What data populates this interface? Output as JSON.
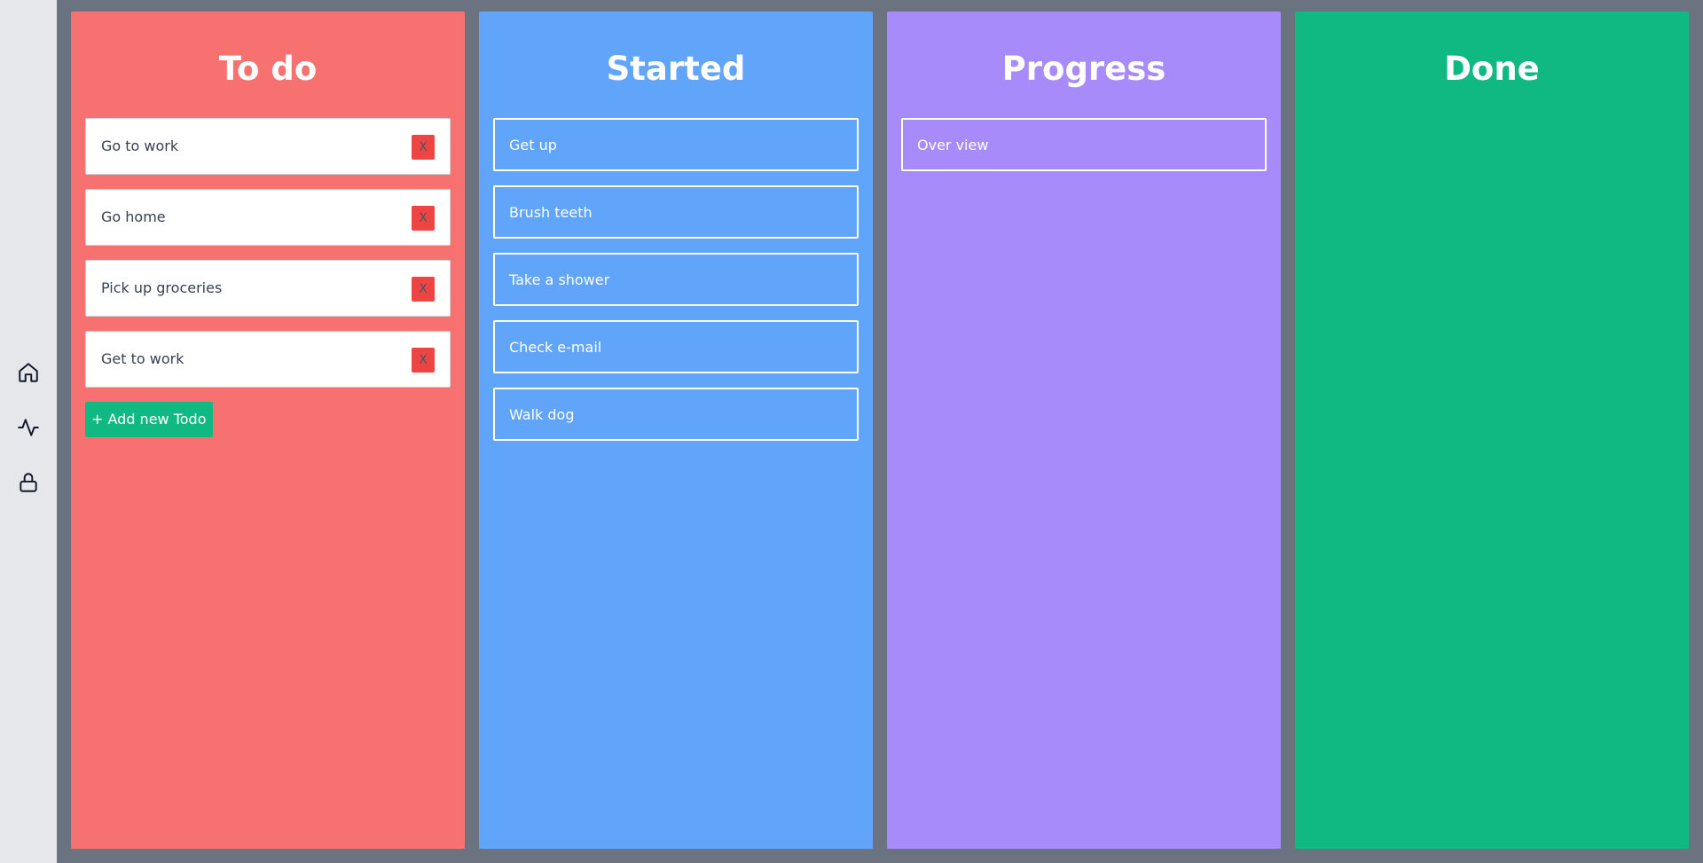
{
  "colors": {
    "sidebar_bg": "#e5e7eb",
    "board_bg": "#6b7280",
    "todo_col": "#f87171",
    "started_col": "#60a5fa",
    "progress_col": "#a78bfa",
    "done_col": "#10b981",
    "delete_btn": "#ef4444",
    "add_btn": "#10b981"
  },
  "sidebar": {
    "icons": [
      "home-icon",
      "activity-icon",
      "lock-icon"
    ]
  },
  "columns": {
    "todo": {
      "title": "To do",
      "cards": [
        {
          "text": "Go to work",
          "delete_label": "X"
        },
        {
          "text": "Go home",
          "delete_label": "X"
        },
        {
          "text": "Pick up groceries",
          "delete_label": "X"
        },
        {
          "text": "Get to work",
          "delete_label": "X"
        }
      ],
      "add_label": "+ Add new Todo"
    },
    "started": {
      "title": "Started",
      "cards": [
        {
          "text": "Get up"
        },
        {
          "text": "Brush teeth"
        },
        {
          "text": "Take a shower"
        },
        {
          "text": "Check e-mail"
        },
        {
          "text": "Walk dog"
        }
      ]
    },
    "progress": {
      "title": "Progress",
      "cards": [
        {
          "text": "Over view"
        }
      ]
    },
    "done": {
      "title": "Done",
      "cards": []
    }
  }
}
